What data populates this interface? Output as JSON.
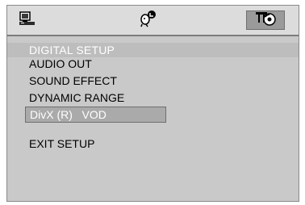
{
  "tabs": [
    {
      "icon": "monitor-icon",
      "selected": false
    },
    {
      "icon": "speaker-person-icon",
      "selected": false
    },
    {
      "icon": "preference-disc-icon",
      "selected": true
    }
  ],
  "page_title": "DIGITAL SETUP",
  "menu": {
    "items": [
      {
        "label": "AUDIO OUT",
        "selected": false
      },
      {
        "label": "SOUND EFFECT",
        "selected": false
      },
      {
        "label": "DYNAMIC RANGE",
        "selected": false
      },
      {
        "label": "DivX (R)   VOD",
        "selected": true
      },
      {
        "label": "EXIT SETUP",
        "selected": false
      }
    ]
  },
  "colors": {
    "panel": "#c9c9c9",
    "highlight": "#aaaaaa",
    "title_text": "#ffffff"
  }
}
